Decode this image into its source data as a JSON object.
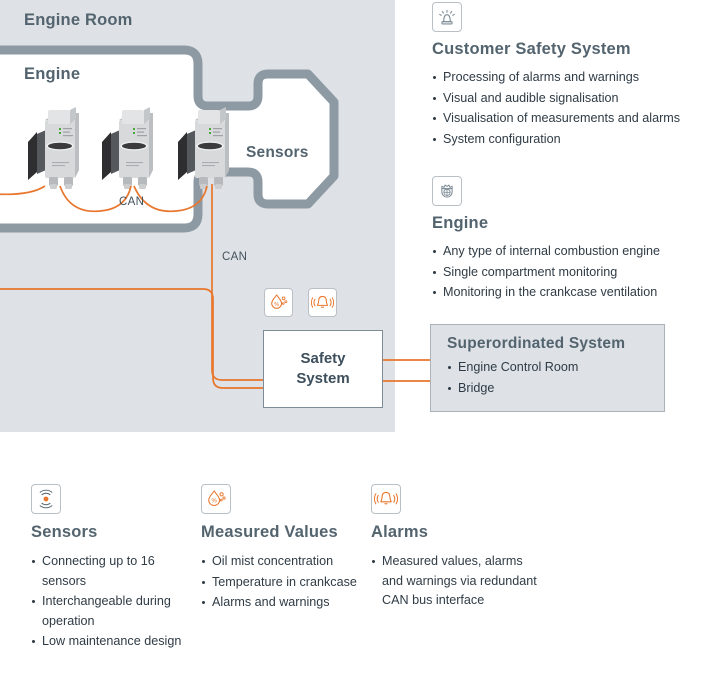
{
  "colors": {
    "panel_bg": "#dee2e6",
    "engine_outline": "#8d9aa3",
    "wire_orange": "#e8762c",
    "heading": "#53646f",
    "body_text": "#2f3b45",
    "box_border": "#7d8c96",
    "icon_border": "#b9c0c6"
  },
  "engine_room": {
    "title": "Engine Room",
    "engine_title": "Engine",
    "sensors_label": "Sensors",
    "can_label_inside": "CAN",
    "can_label_outside": "CAN",
    "sensor_count": 3,
    "sensor_icon": "oil-mist-sensor-device"
  },
  "safety_system": {
    "label": "Safety\nSystem",
    "line1": "Safety",
    "line2": "System",
    "badges": [
      {
        "name": "oil-mist-droplet-icon",
        "title": "Oil mist concentration"
      },
      {
        "name": "alarm-bell-icon",
        "title": "Alarms"
      }
    ]
  },
  "superordinated": {
    "title": "Superordinated System",
    "items": [
      "Engine Control Room",
      "Bridge"
    ]
  },
  "customer_safety": {
    "icon": "alarm-beacon-icon",
    "title": "Customer Safety System",
    "items": [
      "Processing of alarms and warnings",
      "Visual and audible signalisation",
      "Visualisation of measurements and alarms",
      "System configuration"
    ]
  },
  "engine_feature": {
    "icon": "engine-piston-icon",
    "title": "Engine",
    "items": [
      "Any type of internal combustion engine",
      "Single compartment monitoring",
      "Monitoring in the crankcase ventilation"
    ]
  },
  "bottom": {
    "columns": [
      {
        "icon": "sensor-signal-icon",
        "title": "Sensors",
        "items": [
          "Connecting up to 16 sensors",
          "Interchangeable during operation",
          "Low maintenance design"
        ]
      },
      {
        "icon": "oil-mist-droplet-icon",
        "title": "Measured Values",
        "items": [
          "Oil mist concentration",
          "Temperature in crankcase",
          "Alarms and warnings"
        ]
      },
      {
        "icon": "alarm-bell-icon",
        "title": "Alarms",
        "items": [
          "Measured values, alarms and warnings via redundant CAN bus interface"
        ]
      }
    ]
  }
}
